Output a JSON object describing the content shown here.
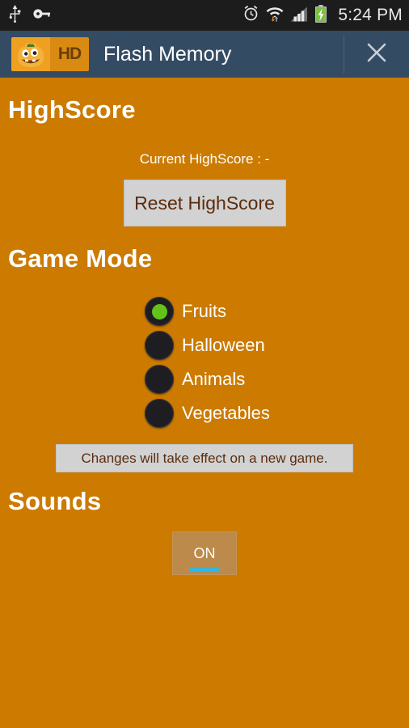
{
  "status_bar": {
    "icons_left": [
      "usb-icon",
      "vpn-key-icon"
    ],
    "icons_right": [
      "alarm-icon",
      "wifi-icon",
      "signal-icon",
      "battery-charging-icon"
    ],
    "time": "5:24 PM"
  },
  "title_bar": {
    "logo_badge": "HD",
    "logo_icon": "pumpkin-icon",
    "app_title": "Flash Memory",
    "close_icon": "close-icon"
  },
  "highscore": {
    "heading": "HighScore",
    "current_label": "Current HighScore : -",
    "reset_button": "Reset HighScore"
  },
  "game_mode": {
    "heading": "Game Mode",
    "options": [
      {
        "label": "Fruits",
        "selected": true
      },
      {
        "label": "Halloween",
        "selected": false
      },
      {
        "label": "Animals",
        "selected": false
      },
      {
        "label": "Vegetables",
        "selected": false
      }
    ],
    "notice": "Changes will take effect on a new game."
  },
  "sounds": {
    "heading": "Sounds",
    "toggle_state": "ON"
  },
  "colors": {
    "background": "#CC7A00",
    "titlebar": "#344C63",
    "statusbar": "#1C1C1C",
    "radio_selected": "#64C318",
    "toggle_accent": "#33B5E5",
    "button_face": "#D2D2D2",
    "button_text": "#5B2C0E"
  }
}
